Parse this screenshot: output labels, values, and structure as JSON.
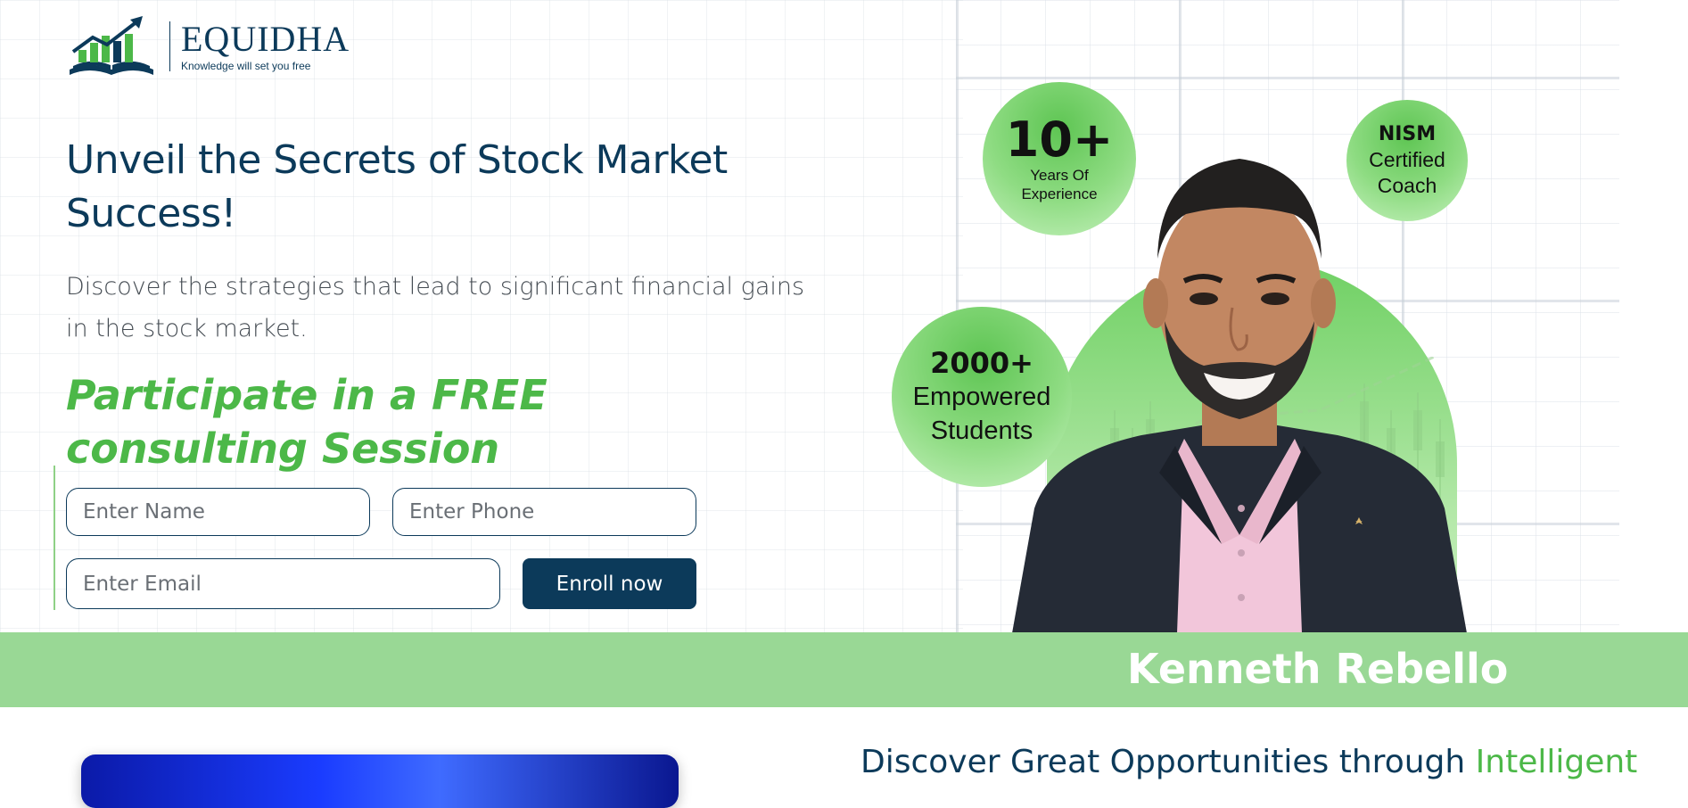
{
  "brand": {
    "name": "EQUIDHA",
    "tagline": "Knowledge will set you free"
  },
  "hero": {
    "headline": "Unveil the Secrets of Stock Market Success!",
    "subheadline": "Discover the strategies that lead to significant financial gains in the stock market.",
    "cta_heading": "Participate in a FREE consulting Session"
  },
  "form": {
    "name_placeholder": "Enter Name",
    "phone_placeholder": "Enter Phone",
    "email_placeholder": "Enter Email",
    "submit_label": "Enroll now"
  },
  "badges": {
    "experience": {
      "value": "10+",
      "caption": "Years Of Experience"
    },
    "certification": {
      "title": "NISM",
      "caption": "Certified Coach"
    },
    "students": {
      "value": "2000+",
      "caption": "Empowered Students"
    }
  },
  "coach": {
    "name": "Kenneth Rebello"
  },
  "next_section": {
    "heading_prefix": "Discover Great Opportunities through",
    "heading_accent": "Intelligent"
  },
  "colors": {
    "primary_navy": "#0c3a5a",
    "accent_green": "#4cb848",
    "band_green": "#99d895",
    "badge_green": "#6fd063"
  },
  "icons": {
    "logo": "book-bar-chart-arrow-logo"
  }
}
